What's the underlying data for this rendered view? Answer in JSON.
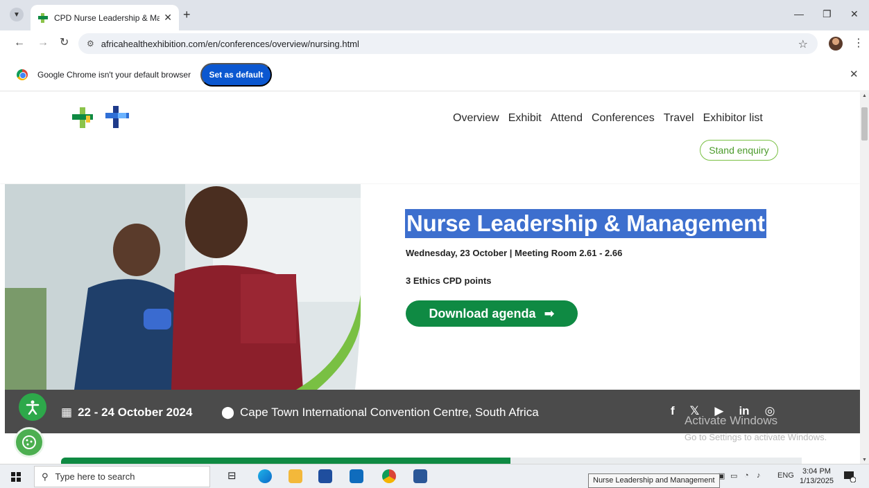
{
  "browser": {
    "tab_title": "CPD Nurse Leadership & Mana",
    "new_tab_symbol": "+",
    "url": "africahealthexhibition.com/en/conferences/overview/nursing.html",
    "infobar_message": "Google Chrome isn't your default browser",
    "set_default_label": "Set as default"
  },
  "site": {
    "nav": [
      "Overview",
      "Exhibit",
      "Attend",
      "Conferences",
      "Travel",
      "Exhibitor list"
    ],
    "stand_enquiry": "Stand enquiry"
  },
  "hero": {
    "title": "Nurse Leadership & Management",
    "date_line": "Wednesday, 23 October | Meeting Room 2.61 - 2.66",
    "cpd": "3 Ethics CPD points",
    "download_label": "Download agenda"
  },
  "strip": {
    "dates": "22 - 24 October 2024",
    "venue": "Cape Town International Convention Centre, South Africa"
  },
  "watermark": {
    "line1": "Activate Windows",
    "line2": "Go to Settings to activate Windows."
  },
  "taskbar": {
    "search_placeholder": "Type here to search",
    "tooltip": "Nurse Leadership and Management",
    "lang": "ENG",
    "time": "3:04 PM",
    "date": "1/13/2025"
  },
  "colors": {
    "brand_green": "#0f8a43",
    "highlight_blue": "#3d6fce",
    "chrome_blue": "#0b57d0",
    "strip_grey": "#4b4b4b"
  }
}
